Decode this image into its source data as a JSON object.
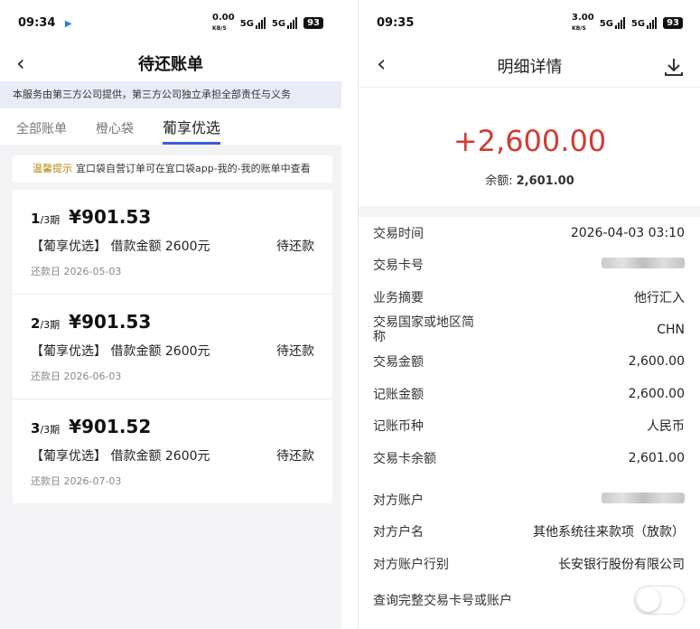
{
  "left": {
    "status": {
      "time": "09:34",
      "speed": "0.00",
      "speed_unit": "KB/S",
      "net1": "5G",
      "net2": "5G",
      "battery": "93"
    },
    "title": "待还账单",
    "notice": "本服务由第三方公司提供，第三方公司独立承担全部责任与义务",
    "tabs": [
      "全部账单",
      "橙心袋",
      "葡享优选"
    ],
    "tip_label": "温馨提示",
    "tip_text": "宜口袋自营订单可在宜口袋app-我的-我的账单中查看",
    "bills": [
      {
        "period": "1",
        "period_total": "/3期",
        "amount": "¥901.53",
        "desc": "【葡享优选】 借款金额 2600元",
        "status": "待还款",
        "date": "还款日 2026-05-03"
      },
      {
        "period": "2",
        "period_total": "/3期",
        "amount": "¥901.53",
        "desc": "【葡享优选】 借款金额 2600元",
        "status": "待还款",
        "date": "还款日 2026-06-03"
      },
      {
        "period": "3",
        "period_total": "/3期",
        "amount": "¥901.52",
        "desc": "【葡享优选】 借款金额 2600元",
        "status": "待还款",
        "date": "还款日 2026-07-03"
      }
    ]
  },
  "right": {
    "status": {
      "time": "09:35",
      "speed": "3.00",
      "speed_unit": "KB/S",
      "net1": "5G",
      "net2": "5G",
      "battery": "93"
    },
    "title": "明细详情",
    "amount": "+2,600.00",
    "balance_label": "余额:",
    "balance_value": "2,601.00",
    "rows": [
      {
        "k": "交易时间",
        "v": "2026-04-03 03:10"
      },
      {
        "k": "交易卡号",
        "v": ""
      },
      {
        "k": "业务摘要",
        "v": "他行汇入"
      },
      {
        "k": "交易国家或地区简称",
        "v": "CHN"
      },
      {
        "k": "交易金额",
        "v": "2,600.00"
      },
      {
        "k": "记账金额",
        "v": "2,600.00"
      },
      {
        "k": "记账币种",
        "v": "人民币"
      },
      {
        "k": "交易卡余额",
        "v": "2,601.00"
      }
    ],
    "rows2": [
      {
        "k": "对方账户",
        "v": ""
      },
      {
        "k": "对方户名",
        "v": "其他系统往来款项（放款）"
      },
      {
        "k": "对方账户行别",
        "v": "长安银行股份有限公司"
      }
    ],
    "query_label": "查询完整交易卡号或账户"
  },
  "colors": {
    "accent": "#3b5bdb",
    "amount_red": "#d23c32"
  }
}
